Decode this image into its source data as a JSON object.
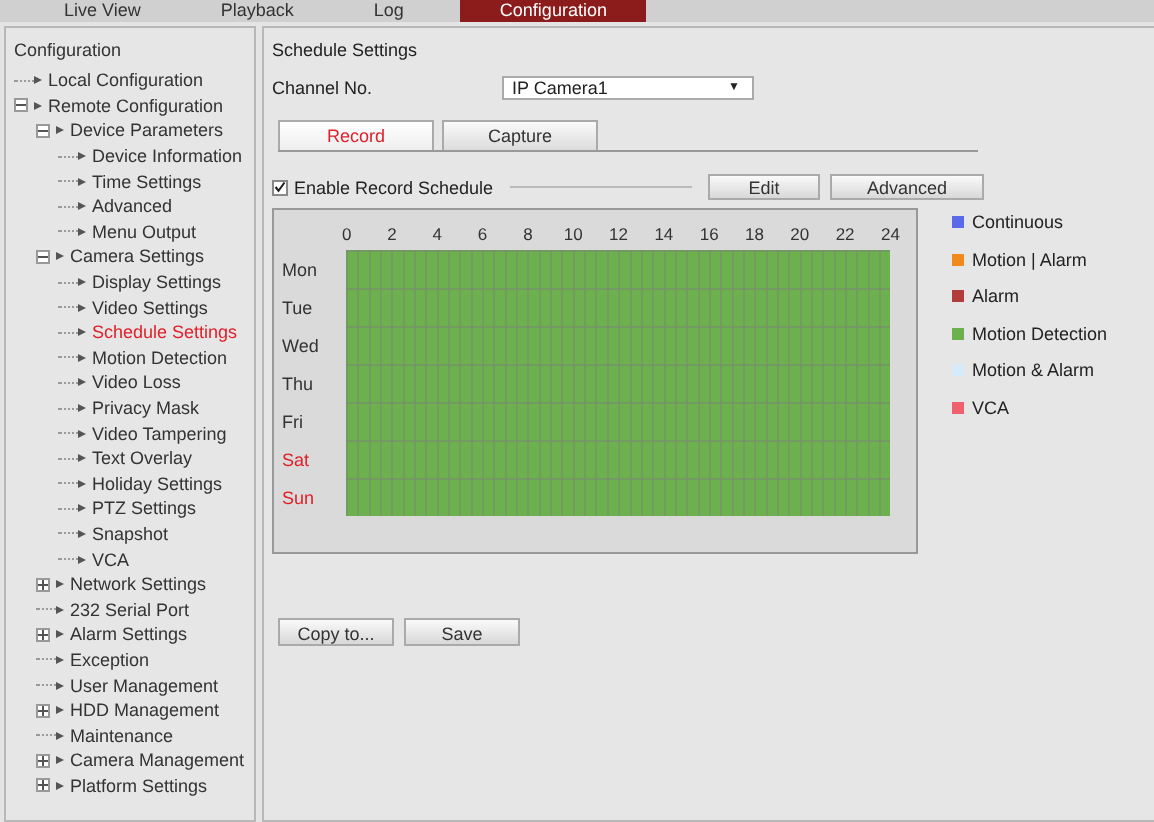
{
  "nav": [
    {
      "label": "Live View",
      "selected": false
    },
    {
      "label": "Playback",
      "selected": false
    },
    {
      "label": "Log",
      "selected": false
    },
    {
      "label": "Configuration",
      "selected": true
    }
  ],
  "sidebar": {
    "title": "Configuration",
    "items": [
      {
        "label": "Local Configuration",
        "kind": "page",
        "selected": false
      },
      {
        "label": "Remote Configuration",
        "kind": "folder",
        "expanded": true,
        "selected": false,
        "children": [
          {
            "label": "Device Parameters",
            "kind": "folder",
            "expanded": true,
            "selected": false,
            "children": [
              {
                "label": "Device Information",
                "kind": "page",
                "selected": false
              },
              {
                "label": "Time Settings",
                "kind": "page",
                "selected": false
              },
              {
                "label": "Advanced",
                "kind": "page",
                "selected": false
              },
              {
                "label": "Menu Output",
                "kind": "page",
                "selected": false
              }
            ]
          },
          {
            "label": "Camera Settings",
            "kind": "folder",
            "expanded": true,
            "selected": false,
            "children": [
              {
                "label": "Display Settings",
                "kind": "page",
                "selected": false
              },
              {
                "label": "Video Settings",
                "kind": "page",
                "selected": false
              },
              {
                "label": "Schedule Settings",
                "kind": "page",
                "selected": true
              },
              {
                "label": "Motion Detection",
                "kind": "page",
                "selected": false
              },
              {
                "label": "Video Loss",
                "kind": "page",
                "selected": false
              },
              {
                "label": "Privacy Mask",
                "kind": "page",
                "selected": false
              },
              {
                "label": "Video Tampering",
                "kind": "page",
                "selected": false
              },
              {
                "label": "Text Overlay",
                "kind": "page",
                "selected": false
              },
              {
                "label": "Holiday Settings",
                "kind": "page",
                "selected": false
              },
              {
                "label": "PTZ Settings",
                "kind": "page",
                "selected": false
              },
              {
                "label": "Snapshot",
                "kind": "page",
                "selected": false
              },
              {
                "label": "VCA",
                "kind": "page",
                "selected": false
              }
            ]
          },
          {
            "label": "Network Settings",
            "kind": "folder",
            "expanded": false,
            "selected": false
          },
          {
            "label": "232 Serial Port",
            "kind": "page",
            "selected": false
          },
          {
            "label": "Alarm Settings",
            "kind": "folder",
            "expanded": false,
            "selected": false
          },
          {
            "label": "Exception",
            "kind": "page",
            "selected": false
          },
          {
            "label": "User Management",
            "kind": "page",
            "selected": false
          },
          {
            "label": "HDD Management",
            "kind": "folder",
            "expanded": false,
            "selected": false
          },
          {
            "label": "Maintenance",
            "kind": "page",
            "selected": false
          },
          {
            "label": "Camera Management",
            "kind": "folder",
            "expanded": false,
            "selected": false
          },
          {
            "label": "Platform Settings",
            "kind": "folder",
            "expanded": false,
            "selected": false
          }
        ]
      }
    ]
  },
  "main": {
    "title": "Schedule Settings",
    "channel_label": "Channel No.",
    "channel_value": "IP Camera1",
    "channel_caret": "▼",
    "tabs": [
      {
        "label": "Record",
        "selected": true
      },
      {
        "label": "Capture",
        "selected": false
      }
    ],
    "enable_schedule": {
      "label": "Enable Record Schedule",
      "checked": true
    },
    "buttons": [
      "Edit",
      "Advanced"
    ],
    "hours": [
      "0",
      "2",
      "4",
      "6",
      "8",
      "10",
      "12",
      "14",
      "16",
      "18",
      "20",
      "22",
      "24"
    ],
    "days": [
      {
        "label": "Mon",
        "weekend": false,
        "color": "#6cb14e"
      },
      {
        "label": "Tue",
        "weekend": false,
        "color": "#6cb14e"
      },
      {
        "label": "Wed",
        "weekend": false,
        "color": "#6cb14e"
      },
      {
        "label": "Thu",
        "weekend": false,
        "color": "#6cb14e"
      },
      {
        "label": "Fri",
        "weekend": false,
        "color": "#6cb14e"
      },
      {
        "label": "Sat",
        "weekend": true,
        "color": "#6cb14e"
      },
      {
        "label": "Sun",
        "weekend": true,
        "color": "#6cb14e"
      }
    ],
    "legend": [
      {
        "label": "Continuous",
        "color": "#5b6aea"
      },
      {
        "label": "Motion | Alarm",
        "color": "#f08a1c"
      },
      {
        "label": "Alarm",
        "color": "#b23c3c"
      },
      {
        "label": "Motion Detection",
        "color": "#6cb14e"
      },
      {
        "label": "Motion & Alarm",
        "color": "#d6eaf8"
      },
      {
        "label": "VCA",
        "color": "#f0606e"
      }
    ],
    "bottom_buttons": [
      "Copy to...",
      "Save"
    ]
  }
}
